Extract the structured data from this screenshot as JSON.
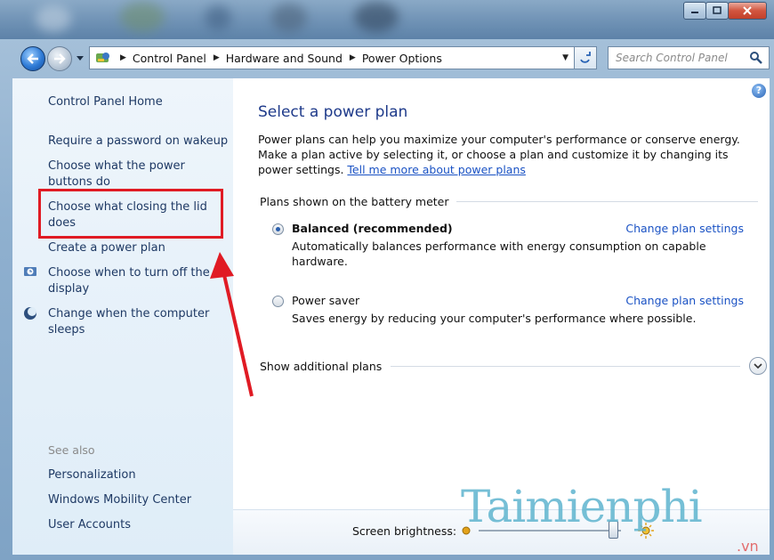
{
  "window": {
    "controls": {
      "minimize_icon": "minimize-icon",
      "maximize_icon": "maximize-icon",
      "close_icon": "close-icon"
    }
  },
  "address": {
    "crumbs": [
      "Control Panel",
      "Hardware and Sound",
      "Power Options"
    ],
    "search_placeholder": "Search Control Panel"
  },
  "sidebar": {
    "home": "Control Panel Home",
    "links": [
      "Require a password on wakeup",
      "Choose what the power buttons do",
      "Choose what closing the lid does",
      "Create a power plan",
      "Choose when to turn off the display",
      "Change when the computer sleeps"
    ],
    "see_also_label": "See also",
    "see_also": [
      "Personalization",
      "Windows Mobility Center",
      "User Accounts"
    ]
  },
  "main": {
    "title": "Select a power plan",
    "description": "Power plans can help you maximize your computer's performance or conserve energy. Make a plan active by selecting it, or choose a plan and customize it by changing its power settings.",
    "learn_more": "Tell me more about power plans",
    "group_label": "Plans shown on the battery meter",
    "plans": [
      {
        "name": "Balanced (recommended)",
        "selected": true,
        "change": "Change plan settings",
        "desc": "Automatically balances performance with energy consumption on capable hardware."
      },
      {
        "name": "Power saver",
        "selected": false,
        "change": "Change plan settings",
        "desc": "Saves energy by reducing your computer's performance where possible."
      }
    ],
    "more_plans": "Show additional plans"
  },
  "brightness": {
    "label": "Screen brightness:",
    "level": 0.95
  },
  "watermark": {
    "text": "Taimienphi",
    "sub": ".vn"
  },
  "colors": {
    "highlight": "#e01b24",
    "link": "#1e3964",
    "title": "#1e3a8a",
    "arrow": "#e01b24"
  }
}
